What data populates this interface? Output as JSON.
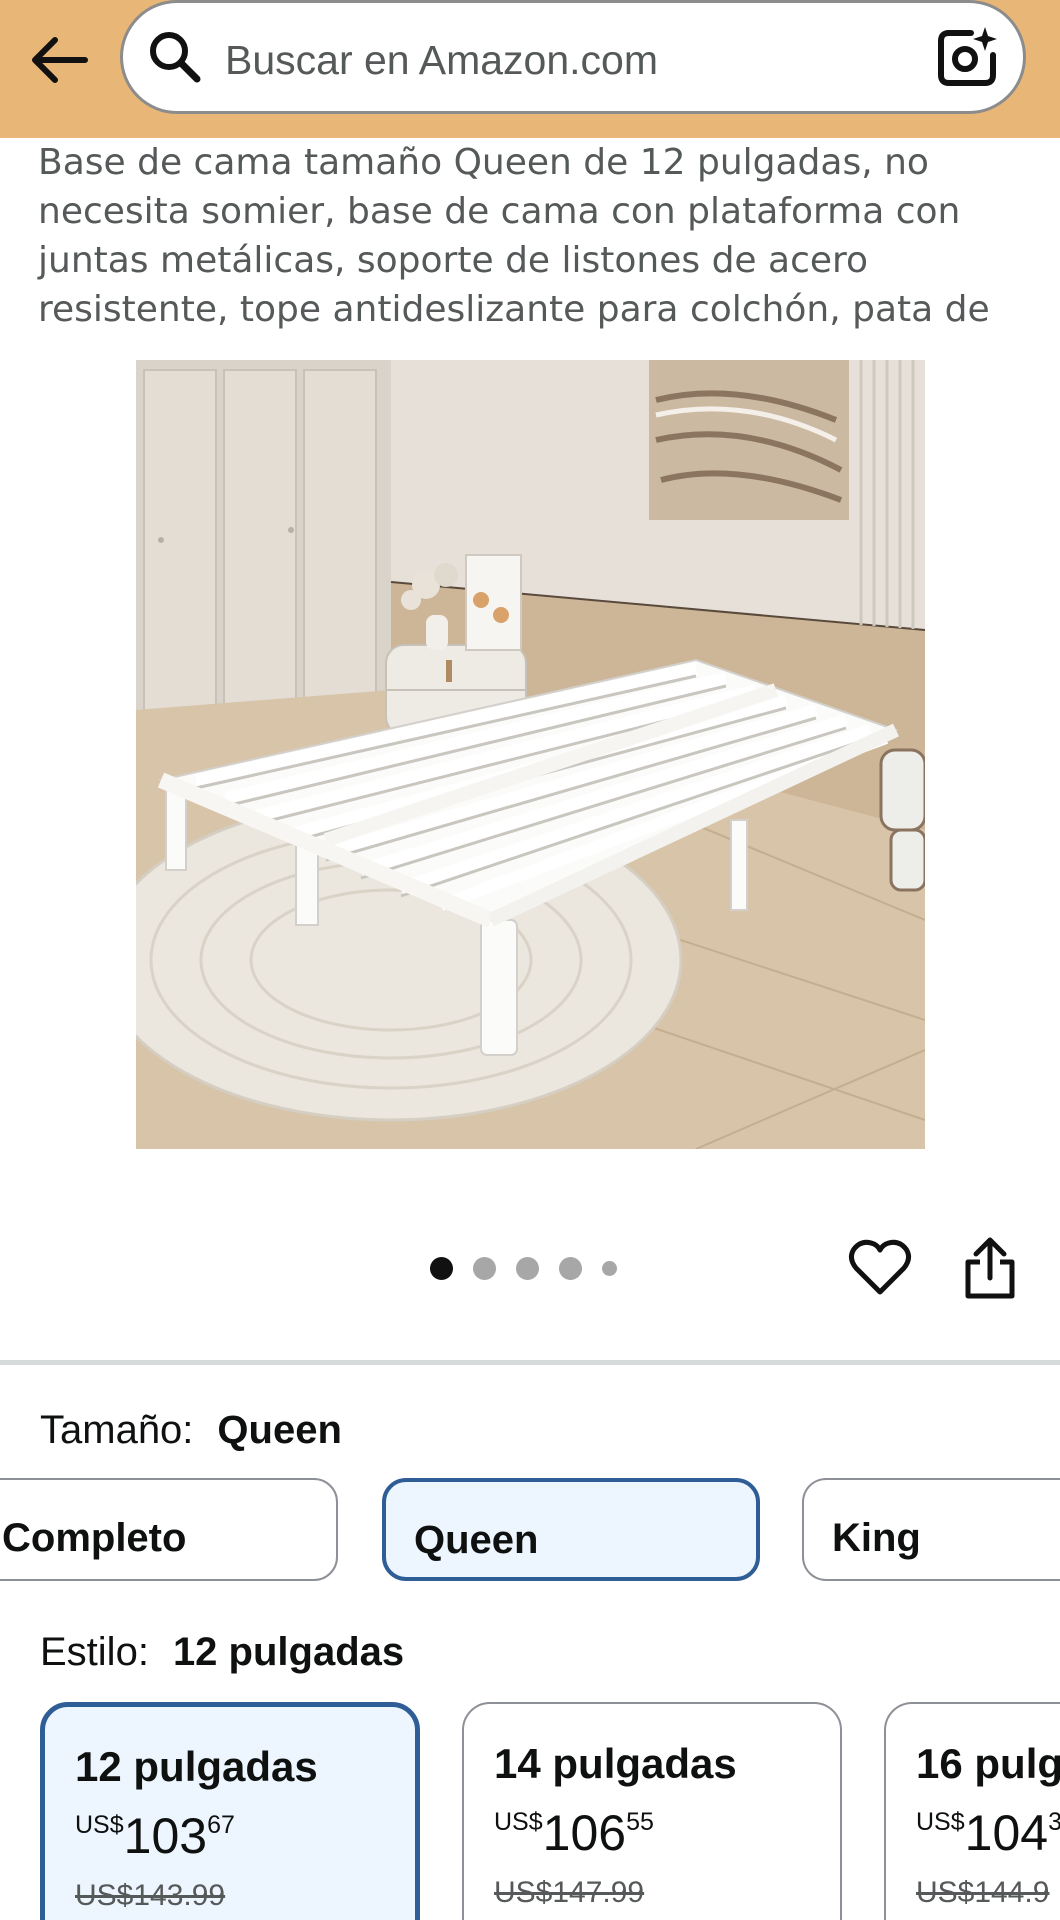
{
  "search": {
    "placeholder": "Buscar en Amazon.com"
  },
  "product": {
    "title": "Base de cama tamaño Queen de 12 pulgadas, no necesita somier, base de cama con plataforma con juntas metálicas, soporte de listones de acero resistente, tope antideslizante para colchón, pata de"
  },
  "carousel": {
    "total_dots": 5,
    "active_index": 0
  },
  "size": {
    "label": "Tamaño:",
    "selected": "Queen",
    "options": [
      "Completo",
      "Queen",
      "King"
    ]
  },
  "style": {
    "label": "Estilo:",
    "selected": "12 pulgadas",
    "options": [
      {
        "name": "12 pulgadas",
        "currency": "US$",
        "whole": "103",
        "fraction": "67",
        "list_price": "US$143.99"
      },
      {
        "name": "14 pulgadas",
        "currency": "US$",
        "whole": "106",
        "fraction": "55",
        "list_price": "US$147.99"
      },
      {
        "name": "16 pulg",
        "currency": "US$",
        "whole": "104",
        "fraction": "3",
        "list_price": "US$144.9"
      }
    ]
  },
  "colors": {
    "header_bg": "#e8b677",
    "selected_border": "#2f5d96",
    "selected_bg": "#edf6ff"
  },
  "icons": [
    "back-arrow-icon",
    "search-icon",
    "camera-search-icon",
    "heart-icon",
    "share-icon"
  ]
}
